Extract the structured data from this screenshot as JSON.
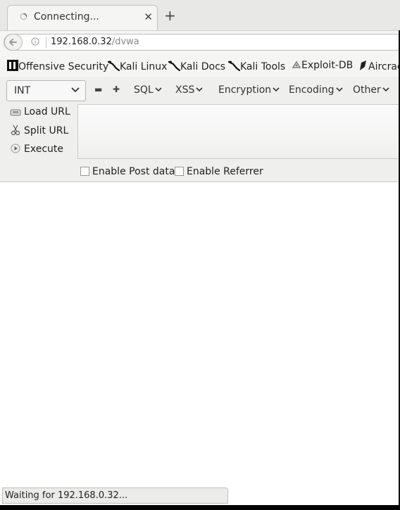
{
  "tab": {
    "title": "Connecting...",
    "close_glyph": "✕",
    "new_tab_glyph": "+"
  },
  "navbar": {
    "url_host": "192.168.0.32",
    "url_path": "/dvwa"
  },
  "bookmarks": [
    {
      "label": "Offensive Security",
      "icon": "offensive-security-icon"
    },
    {
      "label": "Kali Linux",
      "icon": "kali-dragon-icon"
    },
    {
      "label": "Kali Docs",
      "icon": "kali-dragon-icon"
    },
    {
      "label": "Kali Tools",
      "icon": "kali-dragon-icon"
    },
    {
      "label": "Exploit-DB",
      "icon": "exploit-db-icon"
    },
    {
      "label": "Aircrac",
      "icon": "aircrack-icon"
    }
  ],
  "hackbar": {
    "select_value": "INT",
    "minus_glyph": "▬",
    "plus_glyph": "✚",
    "menus": [
      "SQL",
      "XSS",
      "Encryption",
      "Encoding",
      "Other"
    ],
    "load_url": "Load URL",
    "split_url": "Split URL",
    "execute": "Execute",
    "post_data": "Enable Post data",
    "referrer": "Enable Referrer",
    "post_data_checked": false,
    "referrer_checked": false
  },
  "status": {
    "text": "Waiting for 192.168.0.32..."
  }
}
